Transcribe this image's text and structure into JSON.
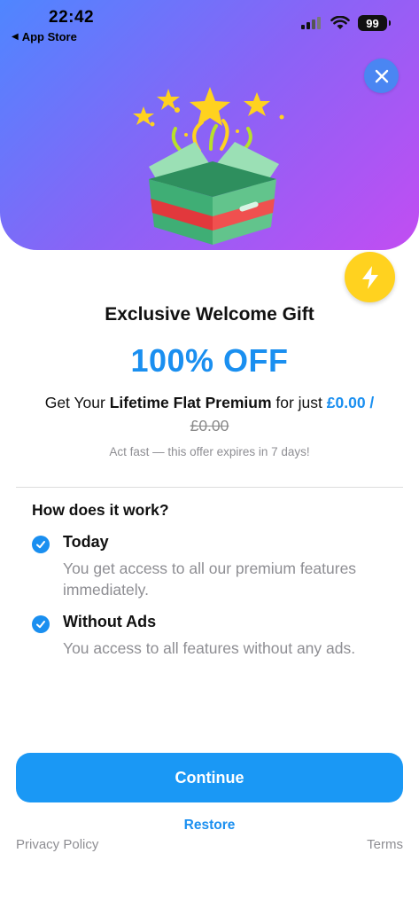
{
  "status_bar": {
    "time": "22:42",
    "back_label": "App Store",
    "battery": "99",
    "icons": [
      "signal-icon",
      "wifi-icon",
      "battery-icon"
    ]
  },
  "hero": {
    "gradient": [
      "#4f86ff",
      "#8a63f6",
      "#c24df2"
    ],
    "close_icon": "close-icon",
    "illustration": "gift-box-icon",
    "badge_icon": "lightning-bolt-icon"
  },
  "offer": {
    "title": "Exclusive Welcome Gift",
    "discount": "100% OFF",
    "prefix": "Get Your ",
    "product": "Lifetime Flat Premium",
    "middle": " for just ",
    "price": "£0.00 /",
    "old_price": "£0.00",
    "expires": "Act fast — this offer expires in 7 days!"
  },
  "how_it_works": {
    "title": "How does it work?",
    "items": [
      {
        "title": "Today",
        "description": "You get access to all our premium features immediately."
      },
      {
        "title": "Without Ads",
        "description": "You access to all features without any ads."
      }
    ]
  },
  "actions": {
    "continue_label": "Continue",
    "restore_label": "Restore",
    "privacy_label": "Privacy Policy",
    "terms_label": "Terms"
  },
  "colors": {
    "accent": "#1a8ff0",
    "button": "#1a98f5",
    "badge": "#ffd21f",
    "muted_text": "#8e8e93"
  }
}
